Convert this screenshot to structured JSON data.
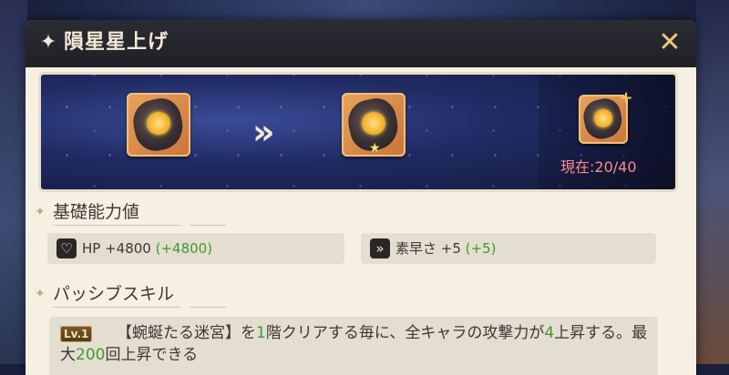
{
  "dialog": {
    "title": "隕星星上げ",
    "close_icon": "close-icon"
  },
  "upgrade": {
    "arrow": "»",
    "current_label": "現在:20/40"
  },
  "basic_stats": {
    "section_title": "基礎能力値",
    "hp": {
      "icon": "heart-icon",
      "label": "HP +4800",
      "bonus": "(+4800)"
    },
    "speed": {
      "icon": "speed-icon",
      "label": "素早さ +5",
      "bonus": "(+5)"
    }
  },
  "passive_skill": {
    "section_title": "パッシブスキル",
    "level": "Lv.1",
    "text_1": "【蜿蜒たる迷宮】を",
    "floor_count": "1",
    "text_2": "階クリアする毎に、全キャラの攻撃力が",
    "increase": "4",
    "text_3": "上昇する。最大",
    "max_times": "200",
    "text_4": "回上昇できる"
  },
  "colors": {
    "accent_green": "#3f9a2e",
    "current_red": "#ff8a8a",
    "close_gold": "#e8c87a"
  }
}
